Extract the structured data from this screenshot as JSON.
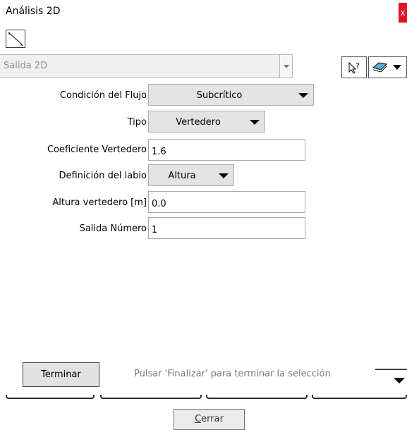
{
  "window": {
    "title": "Análisis 2D",
    "close_label": "x"
  },
  "toolbar": {
    "line_tool_icon": "line-draw-icon",
    "combo_value": "Salida 2D",
    "help_icon": "pointer-help-icon",
    "layer_icon": "layer-select-icon"
  },
  "form": {
    "flow_condition": {
      "label": "Condición del Flujo",
      "value": "Subcrítico"
    },
    "type": {
      "label": "Tipo",
      "value": "Vertedero"
    },
    "weir_coefficient": {
      "label": "Coeficiente Vertedero",
      "value": "1.6"
    },
    "lip_definition": {
      "label": "Definición del labio",
      "value": "Altura"
    },
    "weir_height": {
      "label": "Altura vertedero [m]",
      "value": "0.0"
    },
    "outlet_number": {
      "label": "Salida Número",
      "value": "1"
    }
  },
  "footer": {
    "finish_label": "Terminar",
    "hint": "Pulsar 'Finalizar' para terminar la selección",
    "close_label_accel": "C",
    "close_label_rest": "errar"
  },
  "colors": {
    "close_red": "#e81123",
    "button_gray": "#e3e3e3"
  }
}
